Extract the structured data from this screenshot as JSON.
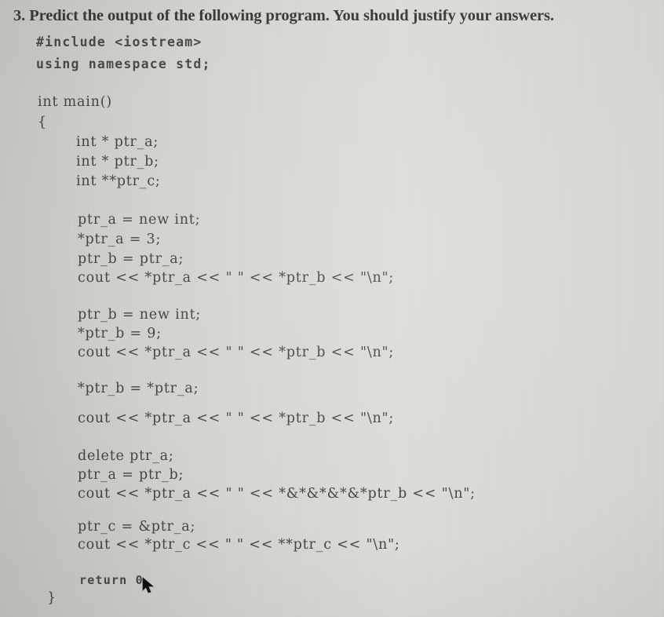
{
  "document": {
    "question": "3. Predict the output of the following program. You should justify your answers.",
    "code_lines": [
      "#include <iostream>",
      "using namespace std;",
      "int main()",
      "{",
      "int * ptr_a;",
      "int * ptr_b;",
      "int **ptr_c;",
      "ptr_a = new int;",
      "*ptr_a = 3;",
      "ptr_b = ptr_a;",
      "cout << *ptr_a << \" \" << *ptr_b << \"\\n\";",
      "ptr_b = new int;",
      "*ptr_b = 9;",
      "cout << *ptr_a << \" \" << *ptr_b << \"\\n\";",
      "*ptr_b = *ptr_a;",
      "cout << *ptr_a << \" \" << *ptr_b << \"\\n\";",
      "delete ptr_a;",
      "ptr_a = ptr_b;",
      "cout << *ptr_a << \" \" << *&*&*&*&*ptr_b << \"\\n\";",
      "ptr_c = &ptr_a;",
      "cout << *ptr_c << \" \" << **ptr_c << \"\\n\";",
      "return 0",
      "}"
    ]
  },
  "icons": {
    "cursor": "mouse-pointer-icon"
  }
}
